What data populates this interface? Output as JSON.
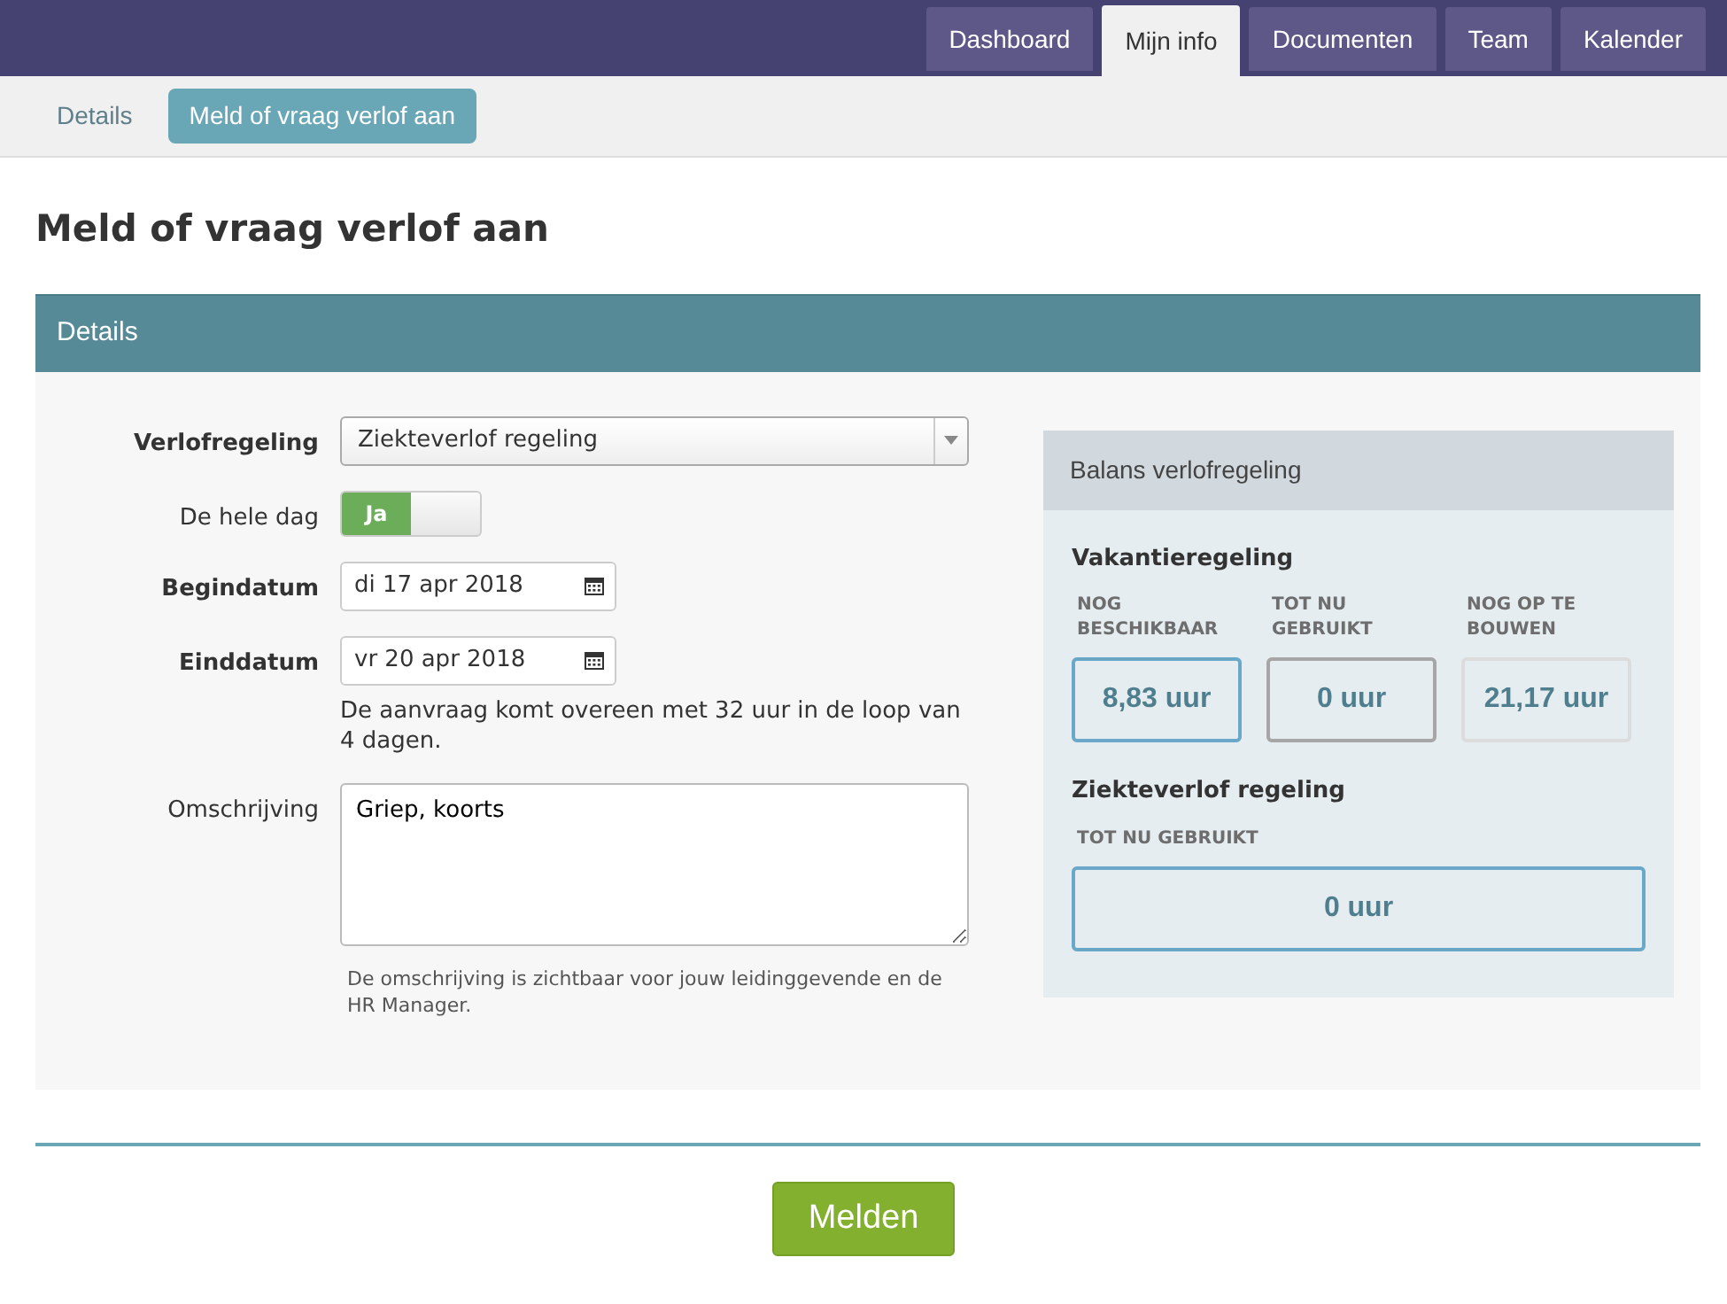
{
  "top_nav": [
    {
      "label": "Dashboard",
      "selected": false
    },
    {
      "label": "Mijn info",
      "selected": true
    },
    {
      "label": "Documenten",
      "selected": false
    },
    {
      "label": "Team",
      "selected": false
    },
    {
      "label": "Kalender",
      "selected": false
    }
  ],
  "sub_nav": [
    {
      "label": "Details",
      "selected": false
    },
    {
      "label": "Meld of vraag verlof aan",
      "selected": true
    }
  ],
  "page_title": "Meld of vraag verlof aan",
  "panel": {
    "title": "Details",
    "form": [
      {
        "kind": "select",
        "label": "Verlofregeling",
        "bold": true,
        "value": "Ziekteverlof regeling"
      },
      {
        "kind": "toggle",
        "label": "De hele dag",
        "bold": false,
        "on": true,
        "on_text": "Ja"
      },
      {
        "kind": "date",
        "label": "Begindatum",
        "bold": true,
        "value": "di 17 apr 2018"
      },
      {
        "kind": "date",
        "label": "Einddatum",
        "bold": true,
        "value": "vr 20 apr 2018",
        "help": "De aanvraag komt overeen met 32 uur in de loop van 4 dagen."
      },
      {
        "kind": "textarea",
        "label": "Omschrijving",
        "bold": false,
        "value": "Griep, koorts",
        "help": "De omschrijving is zichtbaar voor jouw leidinggevende en de HR Manager."
      }
    ],
    "balance": {
      "title": "Balans verlofregeling",
      "groups": [
        {
          "title": "Vakantieregeling",
          "stats": [
            {
              "label": "NOG BESCHIKBAAR",
              "value": "8,83 uur",
              "color": "#6aa8c9"
            },
            {
              "label": "TOT NU GEBRUIKT",
              "value": "0 uur",
              "color": "#a6a6a6"
            },
            {
              "label": "NOG OP TE BOUWEN",
              "value": "21,17 uur",
              "color": "#dcdcdc"
            }
          ]
        },
        {
          "title": "Ziekteverlof regeling",
          "stats": [
            {
              "label": "TOT NU GEBRUIKT",
              "value": "0 uur",
              "color": "#6aa8c9"
            }
          ]
        }
      ]
    }
  },
  "submit": "Melden"
}
